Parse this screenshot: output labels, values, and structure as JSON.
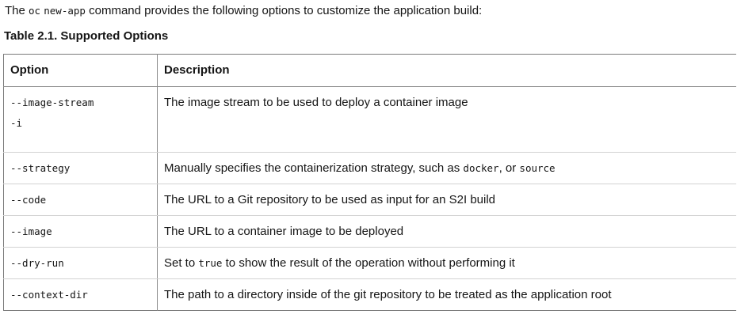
{
  "intro": {
    "before": "The ",
    "code1": "oc",
    "space": " ",
    "code2": "new-app",
    "after": " command provides the following options to customize the application build:"
  },
  "caption": "Table 2.1. Supported Options",
  "table": {
    "headers": [
      "Option",
      "Description"
    ],
    "rows": [
      {
        "options": [
          "--image-stream",
          "-i"
        ],
        "desc": "The image stream to be used to deploy a container image"
      },
      {
        "options": [
          "--strategy"
        ],
        "desc_before": "Manually specifies the containerization strategy, such as ",
        "code_a": "docker",
        "desc_mid": ", or ",
        "code_b": "source"
      },
      {
        "options": [
          "--code"
        ],
        "desc": "The URL to a Git repository to be used as input for an S2I build"
      },
      {
        "options": [
          "--image"
        ],
        "desc": "The URL to a container image to be deployed"
      },
      {
        "options": [
          "--dry-run"
        ],
        "desc_before": "Set to ",
        "code_a": "true",
        "desc_after": " to show the result of the operation without performing it"
      },
      {
        "options": [
          "--context-dir"
        ],
        "desc": "The path to a directory inside of the git repository to be treated as the application root"
      }
    ]
  }
}
